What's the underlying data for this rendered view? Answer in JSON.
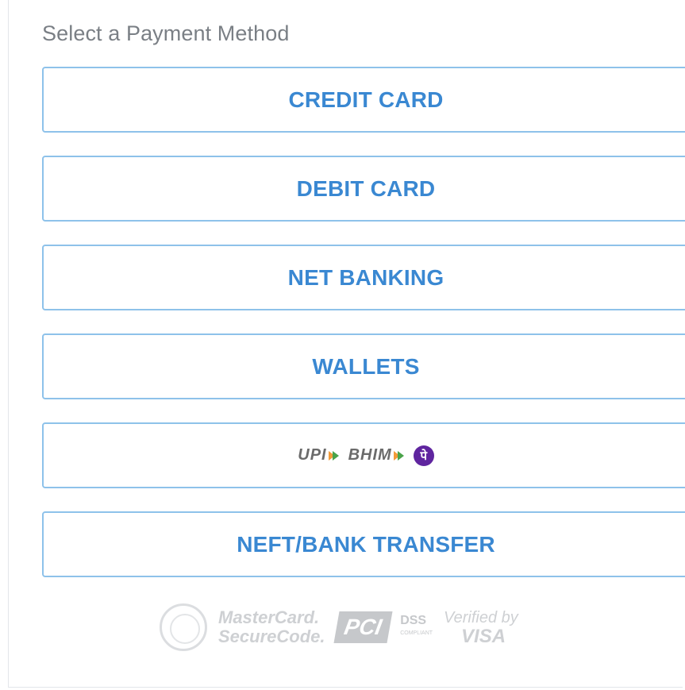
{
  "heading": "Select a Payment Method",
  "methods": [
    {
      "label": "CREDIT CARD"
    },
    {
      "label": "DEBIT CARD"
    },
    {
      "label": "NET BANKING"
    },
    {
      "label": "WALLETS"
    },
    {
      "upi_text": "UPI",
      "bhim_text": "BHIM",
      "phonepe_glyph": "पे"
    },
    {
      "label": "NEFT/BANK TRANSFER"
    }
  ],
  "badges": {
    "mastercard_line1": "MasterCard.",
    "mastercard_line2": "SecureCode.",
    "pci": "PCI",
    "dss": "DSS",
    "dss_sub": "COMPLIANT",
    "verified_by": "Verified by",
    "visa": "VISA"
  },
  "colors": {
    "accent": "#3a88d2",
    "button_border": "#8ec2ea",
    "heading": "#7a7f85"
  }
}
